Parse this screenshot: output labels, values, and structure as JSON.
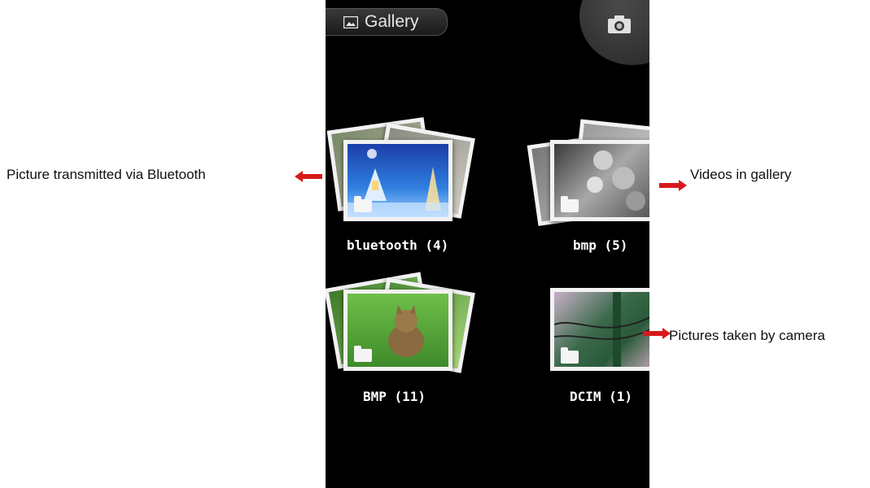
{
  "header": {
    "title": "Gallery",
    "icon": "picture-icon",
    "camera_icon": "camera-icon"
  },
  "albums": [
    {
      "label": "bluetooth (4)"
    },
    {
      "label": "bmp (5)"
    },
    {
      "label": "BMP (11)"
    },
    {
      "label": "DCIM (1)"
    }
  ],
  "annotations": {
    "bluetooth": "Picture transmitted via Bluetooth",
    "videos": "Videos in gallery",
    "camera": "Pictures taken by camera"
  },
  "colors": {
    "arrow": "#d7191c",
    "screen_bg": "#000000"
  }
}
